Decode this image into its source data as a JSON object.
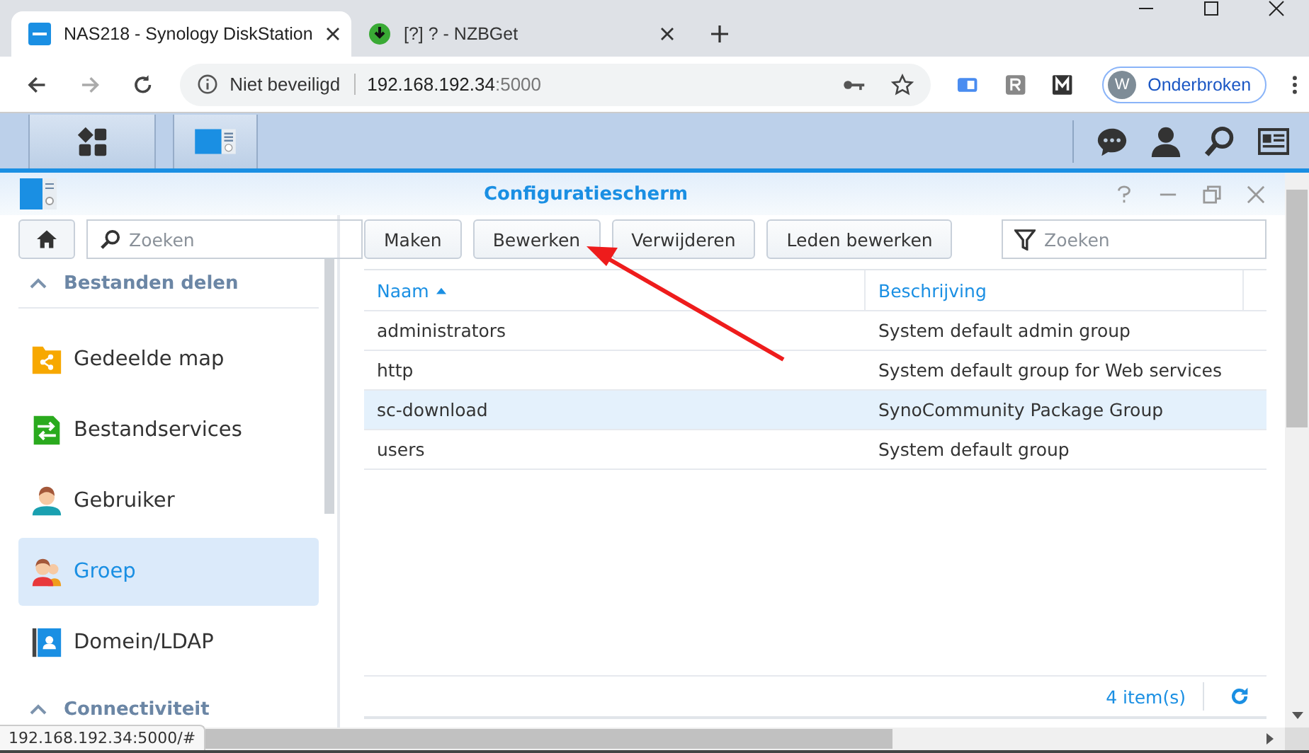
{
  "browser": {
    "tabs": [
      {
        "title": "NAS218 - Synology DiskStation",
        "kind": "dsm",
        "selected": true
      },
      {
        "title": "[?] ? - NZBGet",
        "kind": "download",
        "selected": false
      }
    ],
    "security_label": "Niet beveiligd",
    "url_host": "192.168.192.34",
    "url_port": ":5000",
    "profile": {
      "initial": "W",
      "name": "Onderbroken"
    }
  },
  "window": {
    "title": "Configuratiescherm"
  },
  "sidebar": {
    "search": {
      "placeholder": "Zoeken"
    },
    "sections": [
      {
        "title": "Bestanden delen",
        "expanded": true,
        "items": [
          {
            "label": "Gedeelde map",
            "kind": "shared-folder",
            "selected": false
          },
          {
            "label": "Bestandservices",
            "kind": "file-services",
            "selected": false
          },
          {
            "label": "Gebruiker",
            "kind": "user",
            "selected": false
          },
          {
            "label": "Groep",
            "kind": "group",
            "selected": true
          },
          {
            "label": "Domein/LDAP",
            "kind": "domain",
            "selected": false
          }
        ]
      },
      {
        "title": "Connectiviteit",
        "expanded": true
      }
    ]
  },
  "toolbar": {
    "buttons": [
      "Maken",
      "Bewerken",
      "Verwijderen",
      "Leden bewerken"
    ],
    "filter": {
      "placeholder": "Zoeken"
    }
  },
  "table": {
    "columns": [
      {
        "label": "Naam",
        "sorted": true
      },
      {
        "label": "Beschrijving",
        "sorted": false
      }
    ],
    "rows": [
      {
        "cells": [
          "administrators",
          "System default admin group"
        ],
        "selected": false
      },
      {
        "cells": [
          "http",
          "System default group for Web services"
        ],
        "selected": false
      },
      {
        "cells": [
          "sc-download",
          "SynoCommunity Package Group"
        ],
        "selected": true
      },
      {
        "cells": [
          "users",
          "System default group"
        ],
        "selected": false
      }
    ]
  },
  "footer": {
    "count": "4 item(s)"
  },
  "status_url": "192.168.192.34:5000/#"
}
